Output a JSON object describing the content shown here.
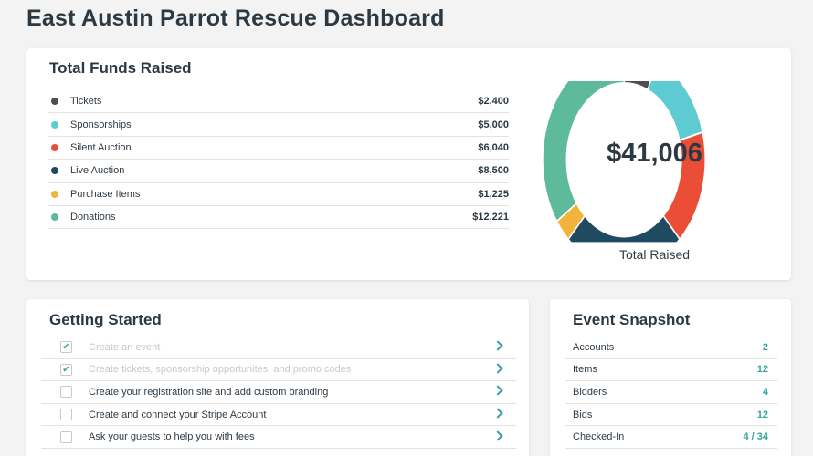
{
  "page": {
    "title": "East Austin Parrot Rescue Dashboard"
  },
  "funds": {
    "title": "Total Funds Raised",
    "items": [
      {
        "label": "Tickets",
        "amount": "$2,400",
        "value": 2400,
        "color": "#4f4d55"
      },
      {
        "label": "Sponsorships",
        "amount": "$5,000",
        "value": 5000,
        "color": "#5ecbd3"
      },
      {
        "label": "Silent Auction",
        "amount": "$6,040",
        "value": 6040,
        "color": "#ea4e37"
      },
      {
        "label": "Live Auction",
        "amount": "$8,500",
        "value": 8500,
        "color": "#1f4a5f"
      },
      {
        "label": "Purchase Items",
        "amount": "$1,225",
        "value": 1225,
        "color": "#f1b33a"
      },
      {
        "label": "Donations",
        "amount": "$12,221",
        "value": 12221,
        "color": "#5dbb9c"
      }
    ],
    "total": "$41,006",
    "total_caption": "Total Raised"
  },
  "getting_started": {
    "title": "Getting Started",
    "items": [
      {
        "label": "Create an event",
        "done": true
      },
      {
        "label": "Create tickets, sponsorship opportunites, and promo codes",
        "done": true
      },
      {
        "label": "Create your registration site and add custom branding",
        "done": false
      },
      {
        "label": "Create and connect your Stripe Account",
        "done": false
      },
      {
        "label": "Ask your guests to help you with fees",
        "done": false
      }
    ]
  },
  "event_snapshot": {
    "title": "Event Snapshot",
    "items": [
      {
        "label": "Accounts",
        "value": "2"
      },
      {
        "label": "Items",
        "value": "12"
      },
      {
        "label": "Bidders",
        "value": "4"
      },
      {
        "label": "Bids",
        "value": "12"
      },
      {
        "label": "Checked-In",
        "value": "4 / 34"
      }
    ]
  },
  "colors": {
    "accent": "#35a8a0",
    "check": "#35a88a",
    "chevron": "#3a9aa8"
  },
  "icons": {
    "check": "check-icon",
    "chevron": "chevron-right-icon",
    "legend": "legend-dot"
  }
}
